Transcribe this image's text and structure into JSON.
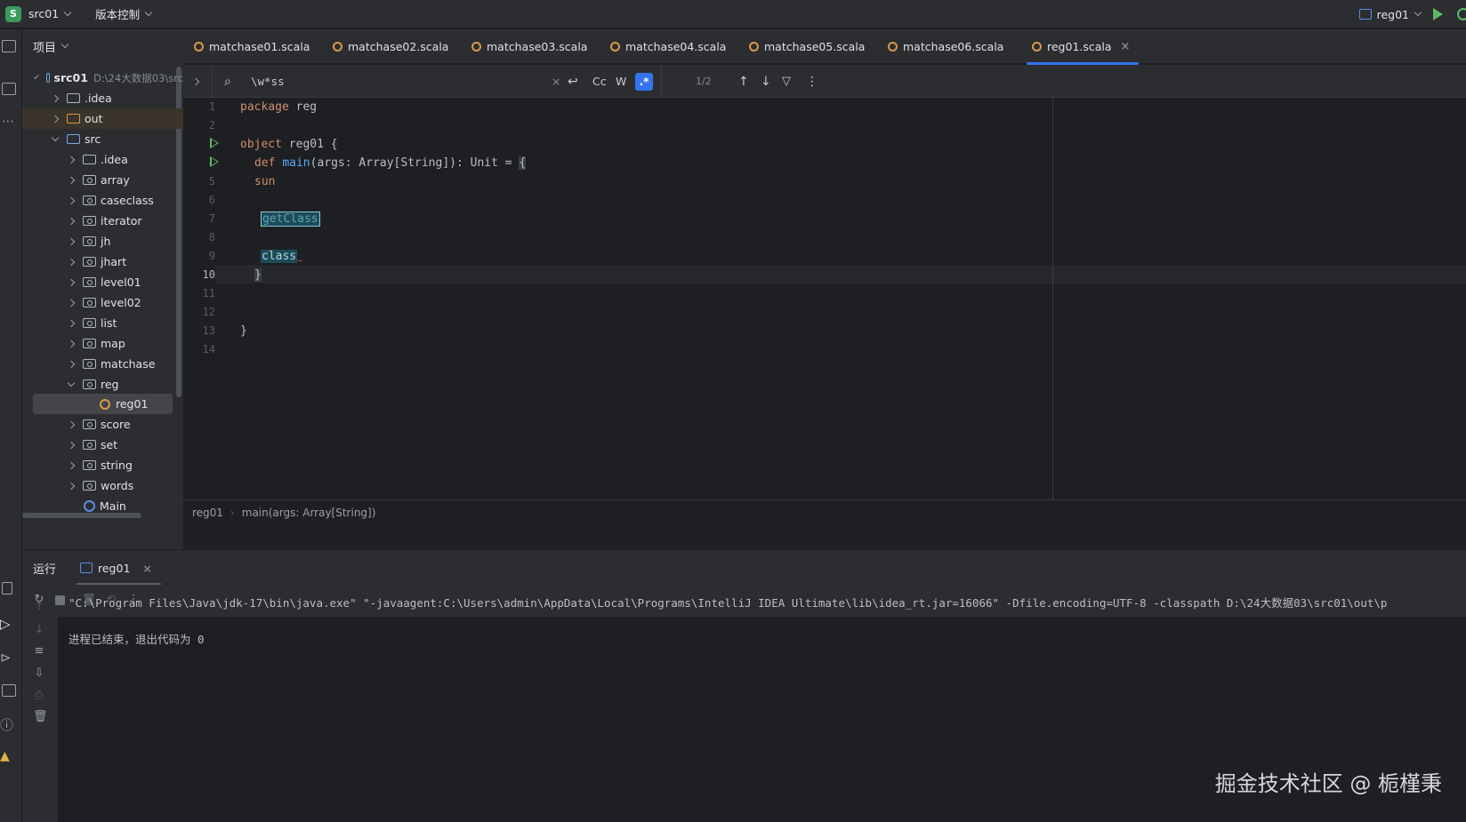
{
  "titlebar": {
    "project_badge": "S",
    "project_name": "src01",
    "vcs_label": "版本控制",
    "run_config": "reg01"
  },
  "project_panel": {
    "title": "项目",
    "root_name": "src01",
    "root_path": "D:\\24大数据03\\src",
    "items": [
      {
        "label": ".idea"
      },
      {
        "label": "out"
      },
      {
        "label": "src"
      },
      {
        "label": ".idea"
      },
      {
        "label": "array"
      },
      {
        "label": "caseclass"
      },
      {
        "label": "iterator"
      },
      {
        "label": "jh"
      },
      {
        "label": "jhart"
      },
      {
        "label": "level01"
      },
      {
        "label": "level02"
      },
      {
        "label": "list"
      },
      {
        "label": "map"
      },
      {
        "label": "matchase"
      },
      {
        "label": "reg"
      },
      {
        "label": "reg01"
      },
      {
        "label": "score"
      },
      {
        "label": "set"
      },
      {
        "label": "string"
      },
      {
        "label": "words"
      },
      {
        "label": "Main"
      }
    ]
  },
  "tabs": [
    {
      "label": "matchase01.scala"
    },
    {
      "label": "matchase02.scala"
    },
    {
      "label": "matchase03.scala"
    },
    {
      "label": "matchase04.scala"
    },
    {
      "label": "matchase05.scala"
    },
    {
      "label": "matchase06.scala"
    },
    {
      "label": "reg01.scala",
      "close": "×"
    }
  ],
  "search": {
    "query": "\\w*ss",
    "clear": "×",
    "match_case": "Cc",
    "words": "W",
    "regex": ".*",
    "count": "1/2"
  },
  "editor": {
    "line_numbers": [
      "1",
      "2",
      "3",
      "4",
      "5",
      "6",
      "7",
      "8",
      "9",
      "10",
      "11",
      "12",
      "13",
      "14"
    ],
    "code": {
      "l1_kw": "package",
      "l1_rest": " reg",
      "l3_kw": "object",
      "l3_rest": " reg01 {",
      "l4_kw": "def",
      "l4_fn": "main",
      "l4_rest": "(args: Array[String]): Unit = ",
      "l4_brace": "{",
      "l5": "sun",
      "l7": "getClass",
      "l9": "class",
      "l10": "}",
      "l13": "}"
    },
    "breadcrumb": [
      "reg01",
      "main(args: Array[String])"
    ]
  },
  "run_panel": {
    "title": "运行",
    "tab_label": "reg01",
    "tab_close": "×",
    "console_lines": [
      "\"C:\\Program Files\\Java\\jdk-17\\bin\\java.exe\" \"-javaagent:C:\\Users\\admin\\AppData\\Local\\Programs\\IntelliJ IDEA Ultimate\\lib\\idea_rt.jar=16066\" -Dfile.encoding=UTF-8 -classpath D:\\24大数据03\\src01\\out\\p",
      "进程已结束，退出代码为 0"
    ]
  },
  "watermark": "掘金技术社区 @ 栀槿秉",
  "colors": {
    "accent": "#3574f0",
    "run_green": "#5fb865",
    "keyword": "#cf8e6d",
    "function": "#56a8f5"
  }
}
